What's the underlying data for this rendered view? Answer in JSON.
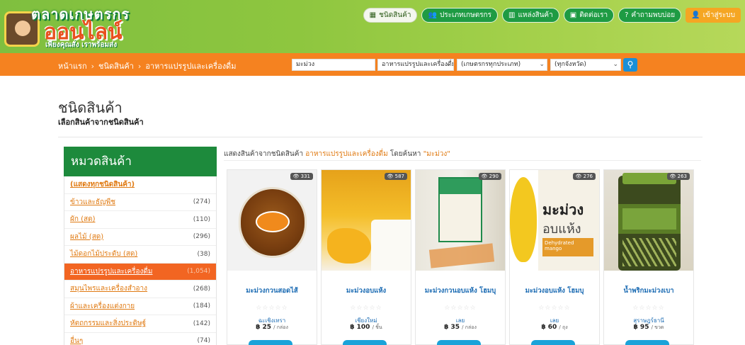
{
  "header": {
    "logo": {
      "top_text": "ตลาดเกษตรกร",
      "main_text": "ออนไลน์",
      "tagline": "เพียงคุณสั่ง เราพร้อมส่ง"
    },
    "nav": [
      {
        "label": "ชนิดสินค้า",
        "icon": "grid-icon",
        "style": "light"
      },
      {
        "label": "ประเภทเกษตรกร",
        "icon": "users-icon",
        "style": "green"
      },
      {
        "label": "แหล่งสินค้า",
        "icon": "map-icon",
        "style": "green"
      },
      {
        "label": "ติดต่อเรา",
        "icon": "contact-icon",
        "style": "green"
      },
      {
        "label": "คำถามพบบ่อย",
        "icon": "question-icon",
        "style": "green"
      },
      {
        "label": "เข้าสู่ระบบ",
        "icon": "user-icon",
        "style": "orange"
      }
    ]
  },
  "searchbar": {
    "breadcrumb": [
      "หน้าแรก",
      "ชนิดสินค้า",
      "อาหารแปรรูปและเครื่องดื่ม"
    ],
    "query": "มะม่วง",
    "category": "อาหารแปรรูปและเครื่องดื่ม",
    "farmer_type": "(เกษตรกรทุกประเภท)",
    "province": "(ทุกจังหวัด)"
  },
  "page": {
    "title": "ชนิดสินค้า",
    "subtitle": "เลือกสินค้าจากชนิดสินค้า"
  },
  "sidebar": {
    "heading": "หมวดสินค้า",
    "items": [
      {
        "label": "(แสดงทุกชนิดสินค้า)",
        "count": ""
      },
      {
        "label": "ข้าวและธัญพืช",
        "count": "(274)"
      },
      {
        "label": "ผัก (สด)",
        "count": "(110)"
      },
      {
        "label": "ผลไม้ (สด)",
        "count": "(296)"
      },
      {
        "label": "ไม้ดอกไม้ประดับ (สด)",
        "count": "(38)"
      },
      {
        "label": "อาหารแปรรูปและเครื่องดื่ม",
        "count": "(1,054)"
      },
      {
        "label": "สมุนไพรและเครื่องสำอาง",
        "count": "(268)"
      },
      {
        "label": "ผ้าและเครื่องแต่งกาย",
        "count": "(184)"
      },
      {
        "label": "หัตถกรรมและสิ่งประดิษฐ์",
        "count": "(142)"
      },
      {
        "label": "อื่นๆ",
        "count": "(74)"
      }
    ],
    "active_index": 5
  },
  "results": {
    "prefix": "แสดงสินค้าจากชนิดสินค้า",
    "category": "อาหารแปรรูปและเครื่องดื่ม",
    "middle": "โดยค้นหา",
    "query": "\"มะม่วง\""
  },
  "products": [
    {
      "name": "มะม่วงกวนสอดไส้",
      "views": "331",
      "stars": "☆☆☆☆☆",
      "location": "ฉะเชิงเทรา",
      "price": "฿ 25",
      "unit": "/ กล่อง"
    },
    {
      "name": "มะม่วงอบแห้ง",
      "views": "587",
      "stars": "☆☆☆☆☆",
      "location": "เชียงใหม่",
      "price": "฿ 100",
      "unit": "/ ชิ้น"
    },
    {
      "name": "มะม่วงกวนอบแห้ง โฮมบุ",
      "views": "290",
      "stars": "☆☆☆☆☆",
      "location": "เลย",
      "price": "฿ 35",
      "unit": "/ กล่อง"
    },
    {
      "name": "มะม่วงอบแห้ง โฮมบุ",
      "views": "276",
      "stars": "☆☆☆☆☆",
      "location": "เลย",
      "price": "฿ 60",
      "unit": "/ ถุง"
    },
    {
      "name": "น้ำพริกมะม่วงเบา",
      "views": "263",
      "stars": "☆☆☆☆☆",
      "location": "สุราษฎร์ธานี",
      "price": "฿ 95",
      "unit": "/ ขวด"
    }
  ],
  "image_text": {
    "p4_line1": "มะม่วง",
    "p4_line2": "อบแห้ง",
    "p4_line3": "Dehydrated mango"
  }
}
